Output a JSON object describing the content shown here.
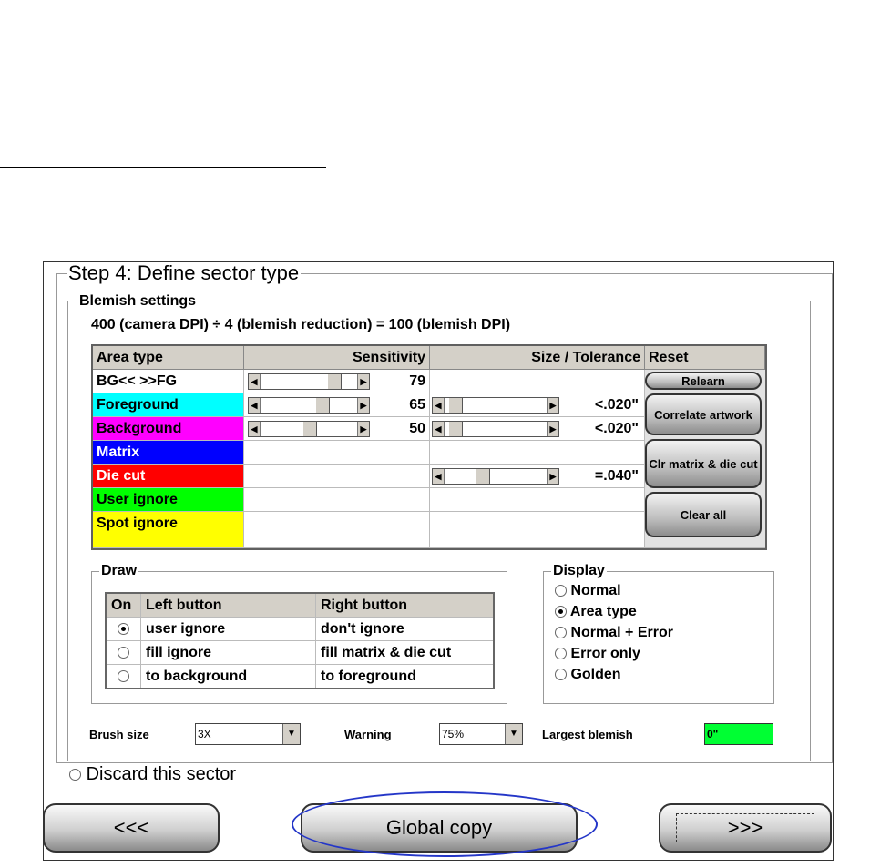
{
  "window": {
    "title": "Step 4: Define sector type"
  },
  "blemish": {
    "title": "Blemish settings",
    "formula": "400 (camera DPI) ÷ 4 (blemish reduction) = 100 (blemish DPI)"
  },
  "grid": {
    "headers": {
      "area": "Area type",
      "sensitivity": "Sensitivity",
      "size": "Size / Tolerance",
      "reset": "Reset"
    },
    "rows": [
      {
        "label": "BG<< >>FG",
        "color": "#ffffff",
        "sens_value": "79",
        "sens_fraction": 0.79,
        "size_value": ""
      },
      {
        "label": "Foreground",
        "color": "#00ffff",
        "sens_value": "65",
        "sens_fraction": 0.65,
        "size_value": "<.020\"",
        "size_fraction": 0.05
      },
      {
        "label": "Background",
        "color": "#ff00ff",
        "sens_value": "50",
        "sens_fraction": 0.5,
        "size_value": "<.020\"",
        "size_fraction": 0.05
      },
      {
        "label": "Matrix",
        "color": "#0000ff"
      },
      {
        "label": "Die cut",
        "color": "#ff0000",
        "size_value": "=.040\"",
        "size_fraction": 0.35
      },
      {
        "label": "User ignore",
        "color": "#00ff00"
      },
      {
        "label": "Spot ignore",
        "color": "#ffff00"
      }
    ],
    "buttons": {
      "relearn": "Relearn",
      "correlate": "Correlate artwork",
      "clr_matrix": "Clr matrix & die cut",
      "clear_all": "Clear all"
    }
  },
  "draw": {
    "title": "Draw",
    "headers": {
      "on": "On",
      "left": "Left button",
      "right": "Right button"
    },
    "rows": [
      {
        "left": "user ignore",
        "right": "don't ignore",
        "selected": true
      },
      {
        "left": "fill ignore",
        "right": "fill matrix & die cut",
        "selected": false
      },
      {
        "left": "to background",
        "right": "to foreground",
        "selected": false
      }
    ]
  },
  "display": {
    "title": "Display",
    "options": [
      "Normal",
      "Area type",
      "Normal + Error",
      "Error only",
      "Golden"
    ],
    "selected": "Area type"
  },
  "bottom": {
    "brush_label": "Brush size",
    "brush_value": "3X",
    "warning_label": "Warning",
    "warning_value": "75%",
    "largest_label": "Largest blemish",
    "largest_value": "0\"",
    "largest_color": "#00ff33"
  },
  "discard": "Discard this sector",
  "nav": {
    "back": "<<<",
    "global_copy": "Global copy",
    "next": ">>>"
  },
  "annotation_color": "#2436c8"
}
